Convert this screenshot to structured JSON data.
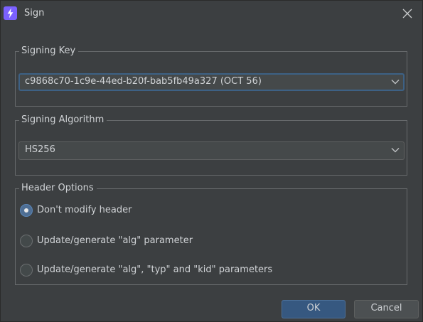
{
  "window": {
    "title": "Sign",
    "app_icon": "lightning-bolt-icon",
    "close_icon": "close-icon"
  },
  "signing_key": {
    "legend": "Signing Key",
    "selected": "c9868c70-1c9e-44ed-b20f-bab5fb49a327 (OCT 56)",
    "arrow_icon": "chevron-down-icon"
  },
  "signing_algorithm": {
    "legend": "Signing Algorithm",
    "selected": "HS256",
    "arrow_icon": "chevron-down-icon"
  },
  "header_options": {
    "legend": "Header Options",
    "options": [
      {
        "label": "Don't modify header",
        "checked": true
      },
      {
        "label": "Update/generate \"alg\" parameter",
        "checked": false
      },
      {
        "label": "Update/generate \"alg\", \"typ\" and \"kid\" parameters",
        "checked": false
      }
    ]
  },
  "buttons": {
    "ok": "OK",
    "cancel": "Cancel"
  },
  "colors": {
    "background": "#3c3f41",
    "accent": "#365880",
    "app_icon": "#7b61ff",
    "focus_border": "#3d6185"
  }
}
